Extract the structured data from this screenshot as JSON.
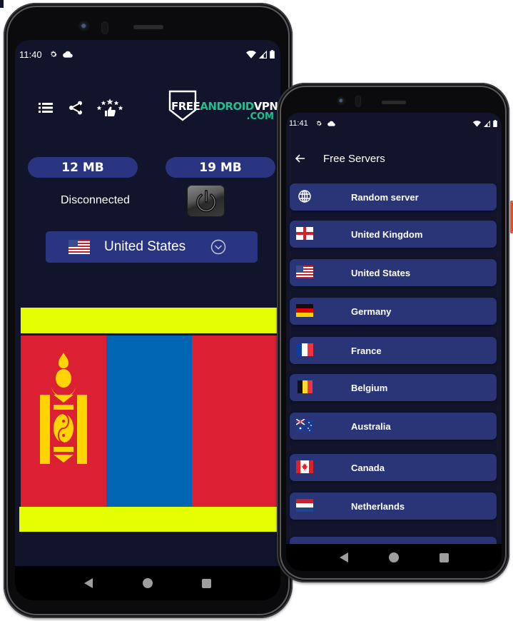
{
  "left_phone": {
    "status_bar": {
      "time": "11:40",
      "icons": [
        "gear-icon",
        "cloud-icon"
      ],
      "right_icons": [
        "wifi-icon",
        "signal-icon",
        "battery-icon"
      ]
    },
    "toolbar": {
      "icons": [
        "menu-list-icon",
        "share-icon",
        "rate-stars-thumbs-up-icon"
      ]
    },
    "logo": {
      "free": "FREE",
      "android": "ANDROID",
      "vpn": "VPN",
      "com": ".COM",
      "colors": {
        "white": "#ffffff",
        "green": "#1fbf8f"
      }
    },
    "stats": {
      "download": "12 MB",
      "upload": "19 MB"
    },
    "connection_status": "Disconnected",
    "power_button": {
      "icon": "power-icon"
    },
    "country_select": {
      "flag": "flag-us",
      "label": "United States",
      "chevron": "chevron-down-circle-icon"
    },
    "current_flag": {
      "country": "Mongolia",
      "colors": {
        "red": "#da2032",
        "blue": "#0066b3",
        "gold": "#ffd400",
        "band": "#e5ff00"
      }
    },
    "nav": [
      "back",
      "home",
      "recents"
    ]
  },
  "right_phone": {
    "status_bar": {
      "time": "11:41",
      "icons": [
        "gear-icon",
        "cloud-icon"
      ],
      "right_icons": [
        "wifi-icon",
        "signal-icon",
        "battery-icon"
      ]
    },
    "appbar": {
      "back_icon": "arrow-left-icon",
      "title": "Free Servers"
    },
    "servers": [
      {
        "flag": "globe",
        "label": "Random server"
      },
      {
        "flag": "england",
        "label": "United Kingdom"
      },
      {
        "flag": "us",
        "label": "United States"
      },
      {
        "flag": "de",
        "label": "Germany"
      },
      {
        "flag": "fr",
        "label": "France"
      },
      {
        "flag": "be",
        "label": "Belgium"
      },
      {
        "flag": "au",
        "label": "Australia"
      },
      {
        "flag": "ca",
        "label": "Canada"
      },
      {
        "flag": "nl",
        "label": "Netherlands"
      },
      {
        "flag": "",
        "label": ""
      }
    ],
    "nav": [
      "back",
      "home",
      "recents"
    ]
  },
  "theme": {
    "screen_bg": "#11142a",
    "card_bg": "#2a3582",
    "list_bg": "#2a3578",
    "text": "#ffffff"
  }
}
